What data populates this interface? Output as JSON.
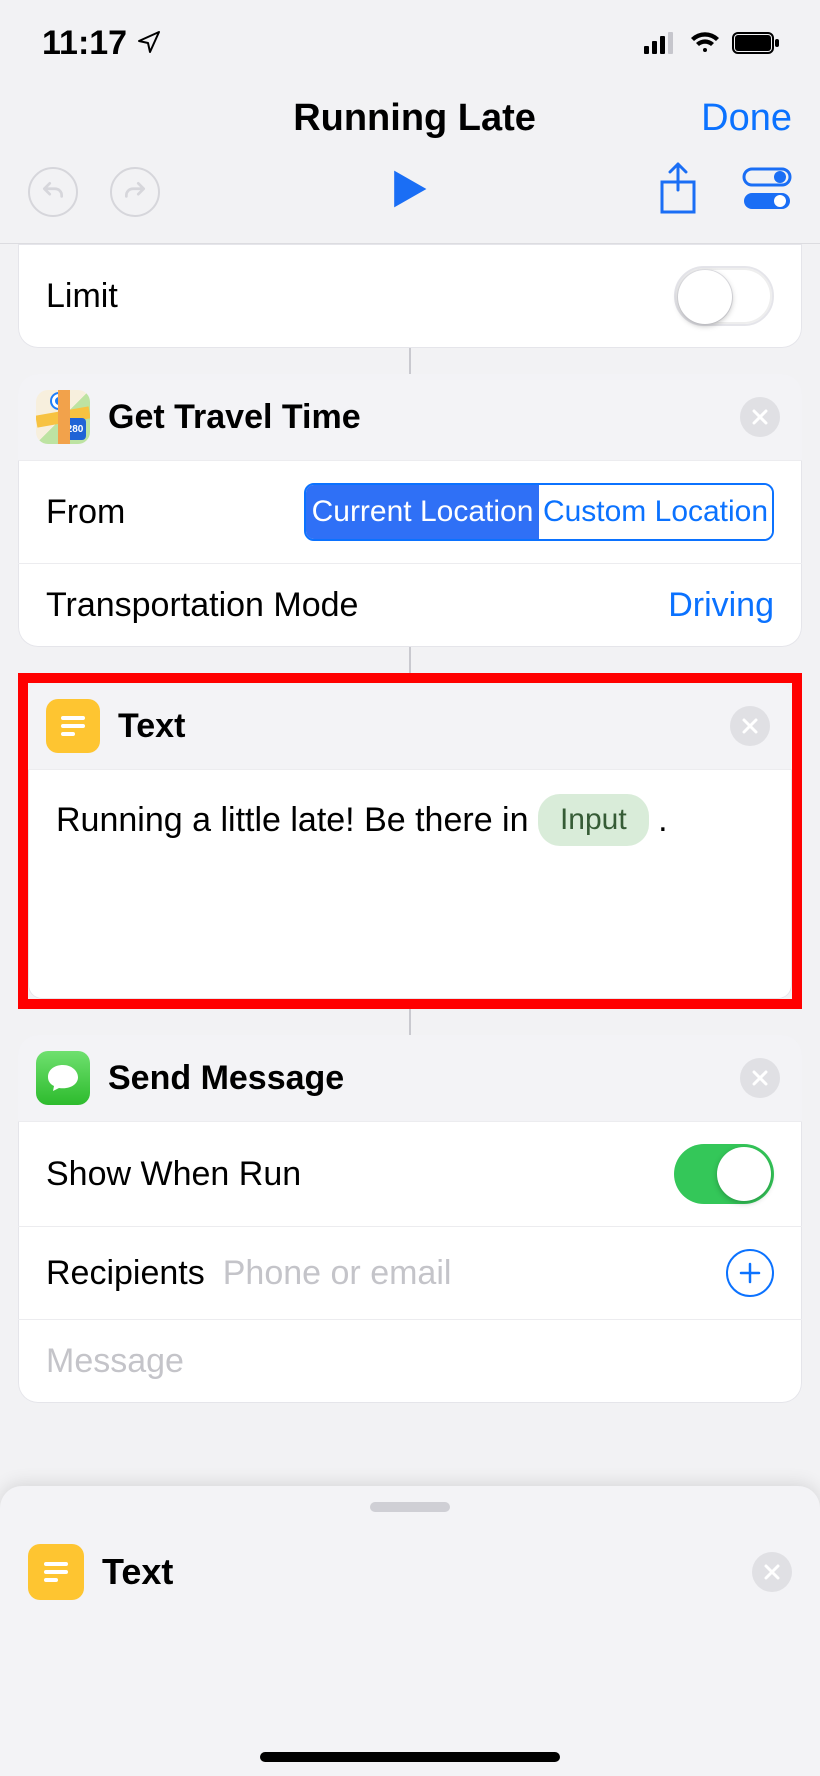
{
  "status": {
    "time": "11:17"
  },
  "nav": {
    "title": "Running Late",
    "done": "Done"
  },
  "limit": {
    "label": "Limit",
    "on": false
  },
  "travel": {
    "title": "Get Travel Time",
    "from_label": "From",
    "segments": {
      "current": "Current Location",
      "custom": "Custom Location",
      "selected": "current"
    },
    "mode_label": "Transportation Mode",
    "mode_value": "Driving"
  },
  "text_action": {
    "title": "Text",
    "body_prefix": "Running a little late! Be there in ",
    "token": "Input",
    "body_suffix": " ."
  },
  "send": {
    "title": "Send Message",
    "show_label": "Show When Run",
    "show_on": true,
    "recipients_label": "Recipients",
    "recipients_placeholder": "Phone or email",
    "message_placeholder": "Message"
  },
  "drawer": {
    "title": "Text"
  },
  "maps_badge": "280"
}
